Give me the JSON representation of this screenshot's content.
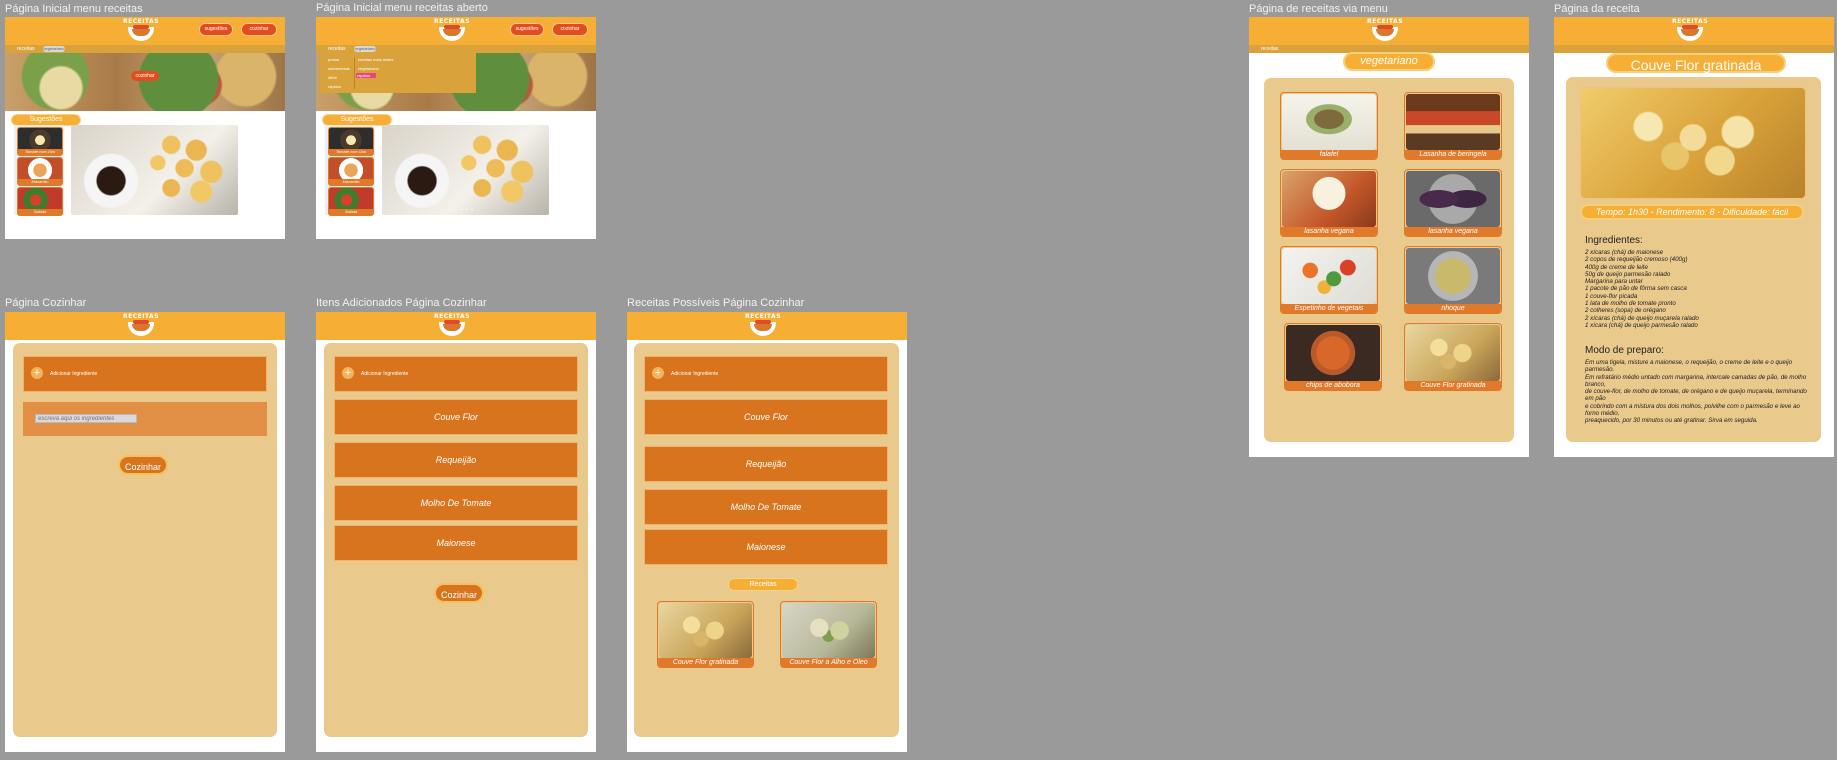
{
  "frames": {
    "inicial": {
      "label": "Página Inicial menu receitas"
    },
    "inicial_aberto": {
      "label": "Página Inicial menu receitas aberto"
    },
    "cozinhar": {
      "label": "Página Cozinhar"
    },
    "itens": {
      "label": "Itens Adicionados Página Cozinhar"
    },
    "possiveis": {
      "label": "Receitas Possíveis Página Cozinhar"
    },
    "via_menu": {
      "label": "Página de receitas via menu"
    },
    "receita": {
      "label": "Página da receita"
    }
  },
  "header": {
    "logo_text": "RECEITAS",
    "nav_sugestoes": "sugestões",
    "nav_cozinhar": "cozinhar",
    "breadcrumb": "receitas",
    "breadcrumb_pill": "vegetariano",
    "hero_cta": "cozinhar"
  },
  "home": {
    "suggestions_title": "Sugestões",
    "thumbs": [
      {
        "label": "Tomate com Ovo"
      },
      {
        "label": "Macarrão"
      },
      {
        "label": "Salada"
      }
    ],
    "carousel_dots": "• • •"
  },
  "dropdown": {
    "left": [
      "pratos",
      "sobremesas",
      "difícil",
      "rápidos"
    ],
    "right": [
      "receitas mais tristes",
      "vegetariano",
      "rápidos",
      ""
    ]
  },
  "cozinhar": {
    "add_label": "Adicionar Ingrediente",
    "input_placeholder": "escreva aqui os ingredientes",
    "cook_button": "Cozinhar",
    "ingredients": [
      "Couve Flor",
      "Requeijão",
      "Molho De Tomate",
      "Maionese"
    ],
    "receitas_pill": "Receitas",
    "results": [
      {
        "label": "Couve Flor gratinada"
      },
      {
        "label": "Couve Flor a Alho e Óleo"
      }
    ]
  },
  "via_menu": {
    "category": "vegetariano",
    "recipes": [
      {
        "label": "falafel"
      },
      {
        "label": "Lasanha de beringela"
      },
      {
        "label": "lasanha vegana"
      },
      {
        "label": "lasanha vegana"
      },
      {
        "label": "Espetinho de vegetais"
      },
      {
        "label": "nhoque"
      },
      {
        "label": "chips de abobora"
      },
      {
        "label": "Couve Flor gratinada"
      }
    ]
  },
  "receita": {
    "title": "Couve Flor gratinada",
    "meta": "Tempo: 1h30 - Rendimento: 8 - Dificuldade: fácil",
    "ingredients_title": "Ingredientes:",
    "ingredients": "2 xícaras (chá) de maionese\n2 copos de requeijão cremoso (400g)\n400g de creme de leite\n50g de queijo parmesão ralado\nMargarina para untar\n1 pacote de pão de fôrma sem casca\n1 couve-flor picada\n1 lata de molho de tomate pronto\n2 colheres (sopa) de orégano\n2 xícaras (chá) de queijo muçarela ralado\n1 xícara (chá) de queijo parmesão ralado",
    "prep_title": "Modo de preparo:",
    "prep": "Em uma tigela, misture a maionese, o requeijão, o creme de leite e o queijo parmesão.\n Em refratário médio untado com margarina, intercale camadas de pão, de molho branco,\nde couve-flor, de molho de tomate, de orégano e de queijo muçarela, terminando em pão\ne cobrindo com a mistura dos dois molhos, polvilhe com o parmesão e leve ao forno médio,\n preaquecido, por 30 minutos ou até gratinar. Sirva em seguida."
  },
  "colors": {
    "canvas": "#9a9a9a",
    "topbar": "#f7ae35",
    "accent": "#d8741d",
    "panel": "#e9c98c",
    "nav_red": "#e24d1f"
  }
}
